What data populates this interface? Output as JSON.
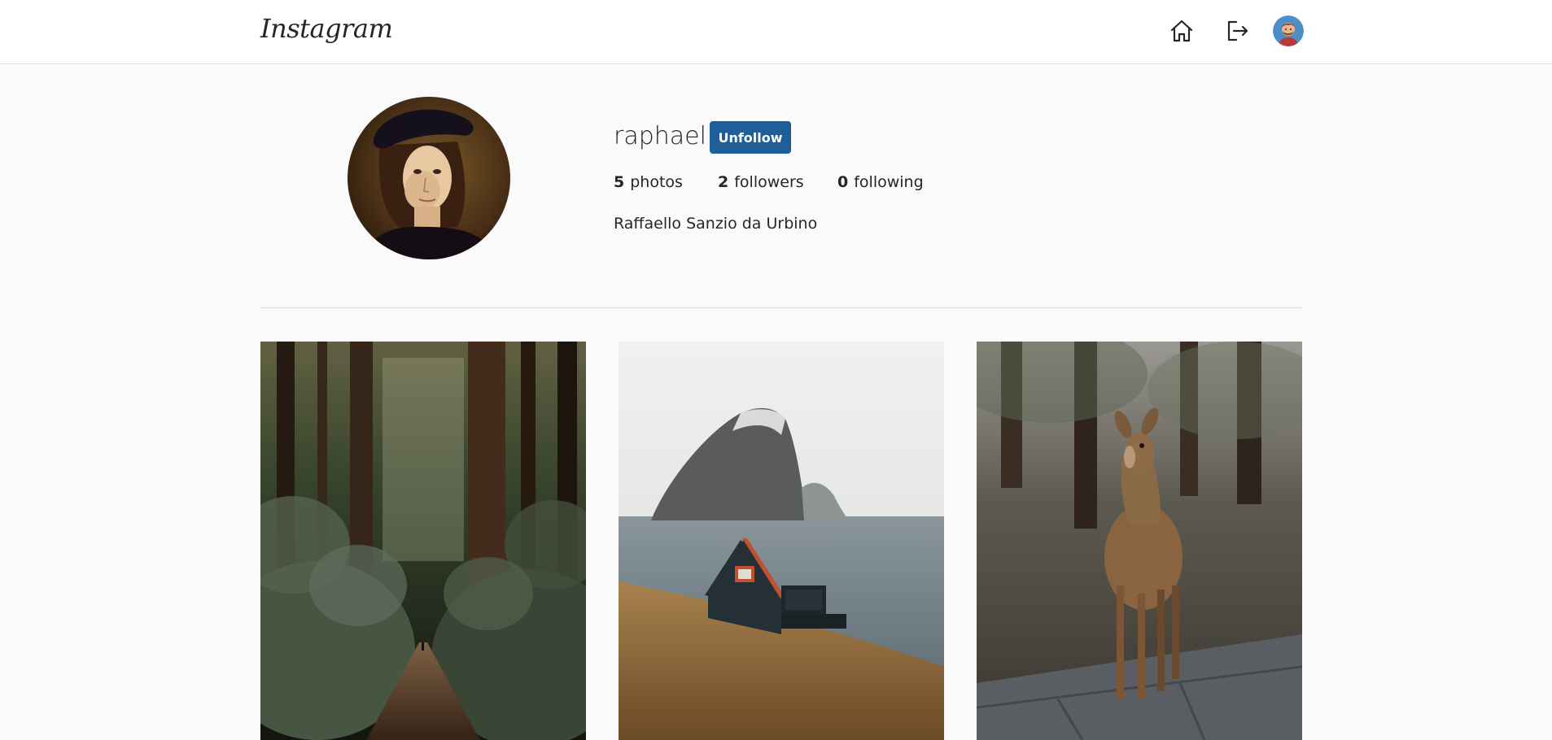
{
  "header": {
    "logo_text": "Instagram",
    "nav": [
      {
        "icon": "home-icon"
      },
      {
        "icon": "logout-icon"
      },
      {
        "icon": "user-avatar"
      }
    ]
  },
  "profile": {
    "username": "raphael",
    "follow_button_label": "Unfollow",
    "stats": {
      "photos_count": "5",
      "photos_label": "photos",
      "followers_count": "2",
      "followers_label": "followers",
      "following_count": "0",
      "following_label": "following"
    },
    "full_name": "Raffaello Sanzio da Urbino"
  },
  "posts": [
    {
      "subject": "forest path with ferns and tall trees"
    },
    {
      "subject": "dark cabin on hillside facing misty sea island"
    },
    {
      "subject": "young deer standing in park"
    }
  ],
  "colors": {
    "button": "#1e5f99",
    "background": "#fafafa",
    "header": "#ffffff",
    "border": "#dbdbdb"
  }
}
